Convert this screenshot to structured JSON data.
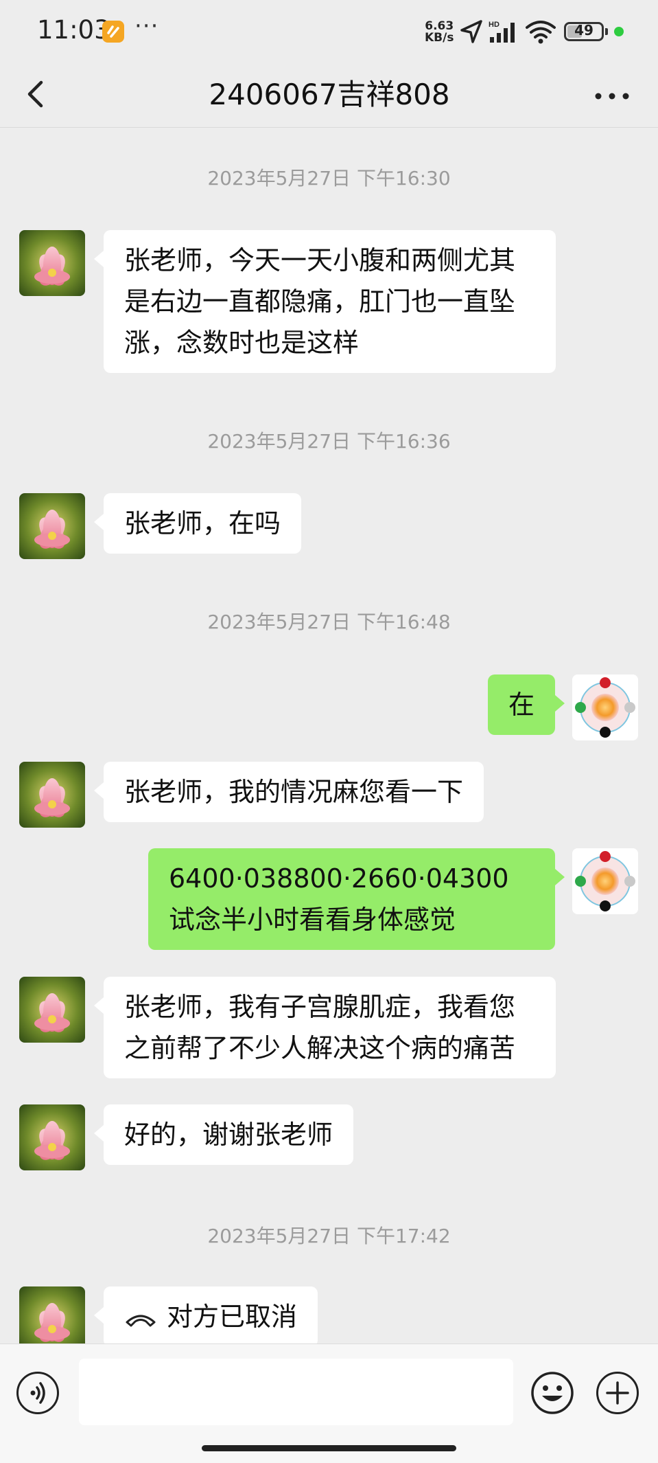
{
  "status_bar": {
    "time": "11:03",
    "more": "···",
    "net_speed_value": "6.63",
    "net_speed_unit": "KB/s",
    "battery": "49",
    "battery_level": 0.49,
    "icons": [
      "app-notification-icon",
      "location-arrow-icon",
      "hd-signal-icon",
      "wifi-icon",
      "battery-icon",
      "active-dot-icon"
    ]
  },
  "nav": {
    "title": "2406067吉祥808",
    "back_icon": "chevron-left-icon",
    "more_icon": "more-dots-icon"
  },
  "chat": {
    "timestamps": [
      "2023年5月27日 下午16:30",
      "2023年5月27日 下午16:36",
      "2023年5月27日 下午16:48",
      "2023年5月27日 下午17:42"
    ],
    "messages": [
      {
        "side": "left",
        "lines": [
          "张老师，今天一天小腹和两侧尤其",
          "是右边一直都隐痛，肛门也一直坠",
          "涨，念数时也是这样"
        ]
      },
      {
        "side": "left",
        "lines": [
          "张老师，在吗"
        ]
      },
      {
        "side": "right",
        "lines": [
          "在"
        ]
      },
      {
        "side": "left",
        "lines": [
          "张老师，我的情况麻您看一下"
        ]
      },
      {
        "side": "right",
        "lines": [
          "6400·038800·2660·04300",
          "试念半小时看看身体感觉"
        ]
      },
      {
        "side": "left",
        "lines": [
          "张老师，我有子宫腺肌症，我看您",
          "之前帮了不少人解决这个病的痛苦"
        ]
      },
      {
        "side": "left",
        "lines": [
          "好的，谢谢张老师"
        ]
      },
      {
        "side": "left",
        "type": "call",
        "lines": [
          "对方已取消"
        ]
      }
    ]
  },
  "input_bar": {
    "voice_icon": "voice-icon",
    "emoji_icon": "emoji-icon",
    "plus_icon": "plus-icon",
    "placeholder": ""
  },
  "colors": {
    "background": "#ededed",
    "bubble_self": "#95ec69",
    "bubble_other": "#ffffff",
    "timestamp": "#9b9b9b"
  }
}
